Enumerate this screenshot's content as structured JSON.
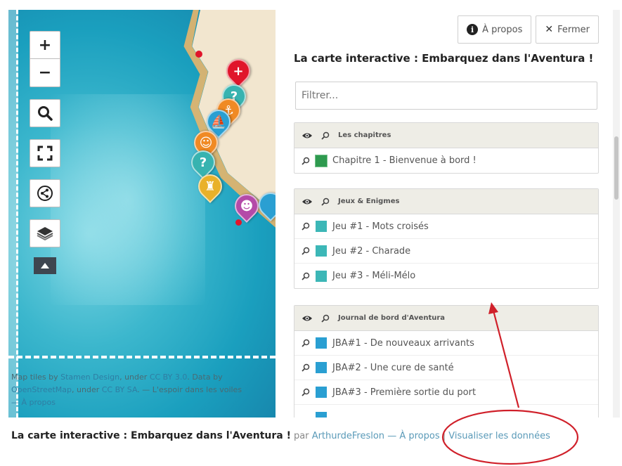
{
  "map": {
    "controls": {
      "zoom_in": "+",
      "zoom_out": "−",
      "icons": [
        "search-icon",
        "fullscreen-icon",
        "share-icon",
        "layers-icon",
        "collapse-up-icon"
      ]
    },
    "attribution": {
      "prefix": "Map tiles by",
      "stamen": "Stamen Design",
      "under1": ", under",
      "cc_by": "CC BY 3.0",
      "data_by": ". Data by",
      "osm": "OpenStreetMap",
      "under2": ", under",
      "cc_by_sa": "CC BY SA",
      "sep": ". — L'espoir dans les voiles",
      "about": "— À propos"
    }
  },
  "panel": {
    "about_label": "À propos",
    "close_label": "Fermer",
    "title": "La carte interactive : Embarquez dans l'Aventura !",
    "filter_placeholder": "Filtrer...",
    "groups": [
      {
        "title": "Les chapitres",
        "color": "#2e9a4f",
        "items": [
          {
            "label": "Chapitre 1 - Bienvenue à bord !"
          }
        ]
      },
      {
        "title": "Jeux & Enigmes",
        "color": "#3cb7b7",
        "items": [
          {
            "label": "Jeu #1 - Mots croisés"
          },
          {
            "label": "Jeu #2 - Charade"
          },
          {
            "label": "Jeu #3 - Méli-Mélo"
          }
        ]
      },
      {
        "title": "Journal de bord d'Aventura",
        "color": "#2a9fd2",
        "items": [
          {
            "label": "JBA#1 - De nouveaux arrivants"
          },
          {
            "label": "JBA#2 - Une cure de santé"
          },
          {
            "label": "JBA#3 - Première sortie du port"
          }
        ]
      }
    ]
  },
  "footer": {
    "title": "La carte interactive : Embarquez dans l'Aventura !",
    "par": "par",
    "author": "ArthurdeFreslon",
    "about": "— À propos",
    "sep": "|",
    "view_data": "Visualiser les données"
  },
  "colors": {
    "annotation": "#d0202a",
    "marker_red": "#e0152b",
    "marker_teal": "#37b3b0",
    "marker_orange": "#f08a24",
    "marker_yellow": "#e9b12a",
    "marker_purple": "#b44aa8"
  }
}
